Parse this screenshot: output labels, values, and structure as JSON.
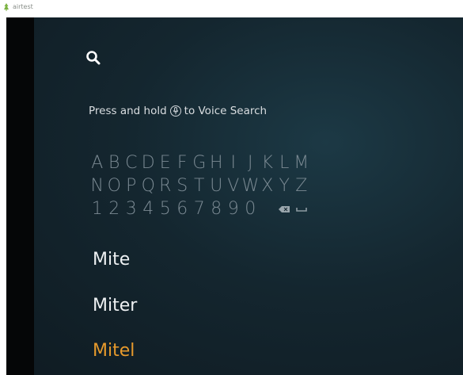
{
  "window": {
    "title": "airtest",
    "accent": "#f39c12"
  },
  "search": {
    "icon": "search-icon",
    "hint_prefix": "Press and hold",
    "hint_icon": "microphone-icon",
    "hint_suffix": "to Voice Search"
  },
  "keyboard": {
    "rows": [
      [
        "A",
        "B",
        "C",
        "D",
        "E",
        "F",
        "G",
        "H",
        "I",
        "J",
        "K",
        "L",
        "M"
      ],
      [
        "N",
        "O",
        "P",
        "Q",
        "R",
        "S",
        "T",
        "U",
        "V",
        "W",
        "X",
        "Y",
        "Z"
      ],
      [
        "1",
        "2",
        "3",
        "4",
        "5",
        "6",
        "7",
        "8",
        "9",
        "0"
      ]
    ],
    "special_keys": [
      "backspace-icon",
      "space-icon"
    ]
  },
  "results": {
    "items": [
      "Mite",
      "Miter",
      "Mitel"
    ],
    "selected_index": 2,
    "selected_color": "#e79a2c"
  }
}
